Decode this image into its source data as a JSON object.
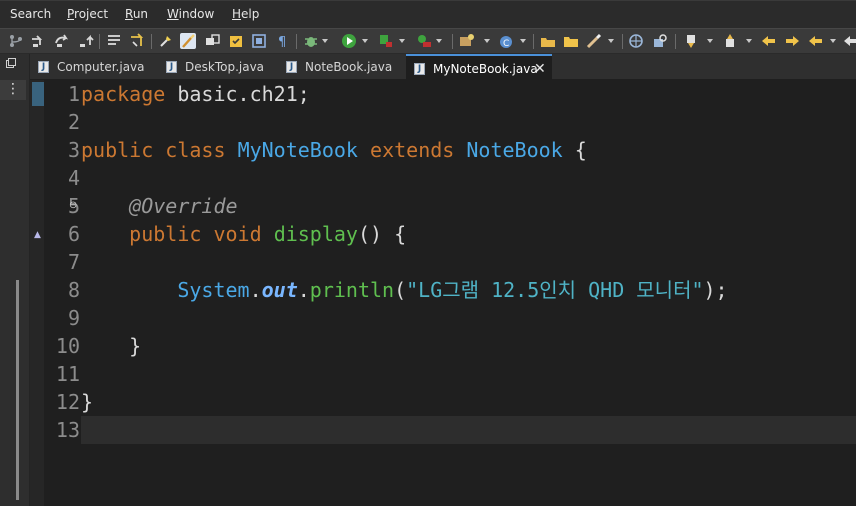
{
  "menu": [
    {
      "pre": "Search",
      "mn": "",
      "post": ""
    },
    {
      "pre": "",
      "mn": "P",
      "post": "roject"
    },
    {
      "pre": "",
      "mn": "R",
      "post": "un"
    },
    {
      "pre": "",
      "mn": "W",
      "post": "indow"
    },
    {
      "pre": "",
      "mn": "H",
      "post": "elp"
    }
  ],
  "toolbar_icons": [
    "git-branch-icon",
    "step-into-icon",
    "step-over-icon",
    "step-return-icon",
    "drop-frame-icon",
    "use-step-filters-icon",
    "open-type-icon",
    "toggle-mark-occurrences-icon",
    "toggle-breadcrumb-icon",
    "open-task-icon",
    "block-selection-icon",
    "show-whitespace-icon",
    "debug-icon",
    "run-icon",
    "coverage-icon",
    "external-tools-icon",
    "new-java-project-icon",
    "new-java-package-icon",
    "new-java-class-icon",
    "open-folder-icon",
    "edit-icon",
    "web-browser-icon",
    "search-icon",
    "next-annotation-icon",
    "previous-annotation-icon",
    "last-edit-location-icon",
    "back-icon",
    "forward-icon",
    "pin-editor-icon"
  ],
  "side": {
    "icon": "minimize-icon",
    "menu_glyph": "⋮"
  },
  "tabs": [
    {
      "label": "Computer.java",
      "active": false
    },
    {
      "label": "DeskTop.java",
      "active": false
    },
    {
      "label": "NoteBook.java",
      "active": false
    },
    {
      "label": "MyNoteBook.java",
      "active": true
    }
  ],
  "tab_close_glyph": "✕",
  "line_numbers": [
    "1",
    "2",
    "3",
    "4",
    "5",
    "6",
    "7",
    "8",
    "9",
    "10",
    "11",
    "12",
    "13"
  ],
  "code": {
    "l1": {
      "kw": "package",
      "rest": " basic.ch21;"
    },
    "l3": {
      "kw1": "public",
      "kw2": "class",
      "name": "MyNoteBook",
      "kw3": "extends",
      "parent": "NoteBook",
      "brace": " {"
    },
    "l5": {
      "indent": "    ",
      "ann": "@Override"
    },
    "l6": {
      "indent": "    ",
      "kw1": "public",
      "kw2": "void",
      "meth": "display",
      "rest": "() {"
    },
    "l8": {
      "indent": "        ",
      "cls": "System",
      "dot1": ".",
      "fld": "out",
      "dot2": ".",
      "meth": "println",
      "open": "(",
      "str": "\"LG그램 12.5인치 QHD 모니터\"",
      "close": ");"
    },
    "l10": {
      "text": "    }"
    },
    "l12": {
      "text": "}"
    }
  },
  "fold_glyph": "⊖",
  "override_glyph": "▲"
}
